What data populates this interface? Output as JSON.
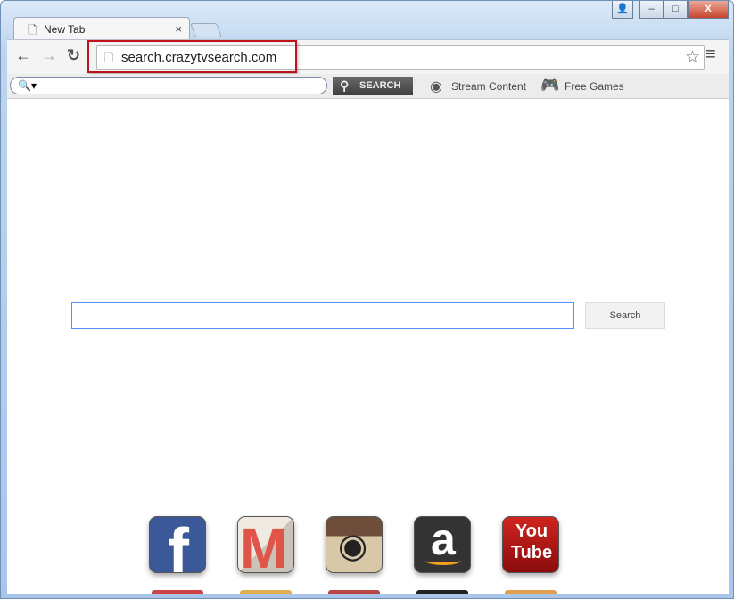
{
  "tab": {
    "title": "New Tab",
    "close": "×"
  },
  "window_buttons": {
    "user": "👤",
    "minimize": "–",
    "maximize": "□",
    "close": "X"
  },
  "toolbar": {
    "back": "←",
    "forward": "→",
    "reload": "↻",
    "url": "search.crazytvsearch.com",
    "star": "☆",
    "menu": "≡"
  },
  "extension_bar": {
    "search_icon": "🔍▾",
    "search_button": "SEARCH",
    "stream_label": "Stream Content",
    "games_label": "Free Games"
  },
  "page": {
    "search_button": "Search",
    "search_value": ""
  },
  "apps": [
    {
      "name": "Facebook",
      "glyph": "f",
      "color": "#3b5998"
    },
    {
      "name": "Gmail",
      "glyph": "M",
      "color": "#e0554a"
    },
    {
      "name": "Instagram",
      "glyph": "◉",
      "color": "#c9b28f"
    },
    {
      "name": "Amazon",
      "glyph": "a",
      "color": "#333333"
    },
    {
      "name": "YouTube",
      "glyph": "You Tube",
      "color": "#b31217"
    }
  ]
}
